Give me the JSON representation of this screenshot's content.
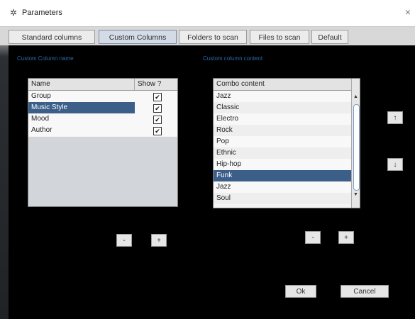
{
  "window": {
    "title": "Parameters",
    "close_glyph": "×",
    "app_icon": "gear-icon"
  },
  "tabs": [
    {
      "label": "Standard columns"
    },
    {
      "label": "Custom Columns",
      "active": true
    },
    {
      "label": "Folders to scan"
    },
    {
      "label": "Files to scan"
    },
    {
      "label": "Default"
    }
  ],
  "left_panel": {
    "label": "Custom Column name",
    "headers": {
      "name": "Name",
      "show": "Show ?"
    },
    "rows": [
      {
        "name": "Group",
        "checked": true
      },
      {
        "name": "Music Style",
        "checked": true,
        "selected": true
      },
      {
        "name": "Mood",
        "checked": true
      },
      {
        "name": "Author",
        "checked": true
      }
    ],
    "remove_label": "-",
    "add_label": "+"
  },
  "right_panel": {
    "label": "Custom column content",
    "header": "Combo content",
    "items": [
      "Jazz",
      "Classic",
      "Electro",
      "Rock",
      "Pop",
      "Ethnic",
      "Hip-hop",
      "Funk",
      "Jazz",
      "Soul"
    ],
    "selected_index": 7,
    "remove_label": "-",
    "add_label": "+",
    "up_label": "↑",
    "down_label": "↓"
  },
  "footer": {
    "ok_label": "Ok",
    "cancel_label": "Cancel"
  },
  "colors": {
    "selection": "#3b5f89",
    "section_label": "#2c6aa8",
    "tab_active": "#d3dbe6"
  }
}
